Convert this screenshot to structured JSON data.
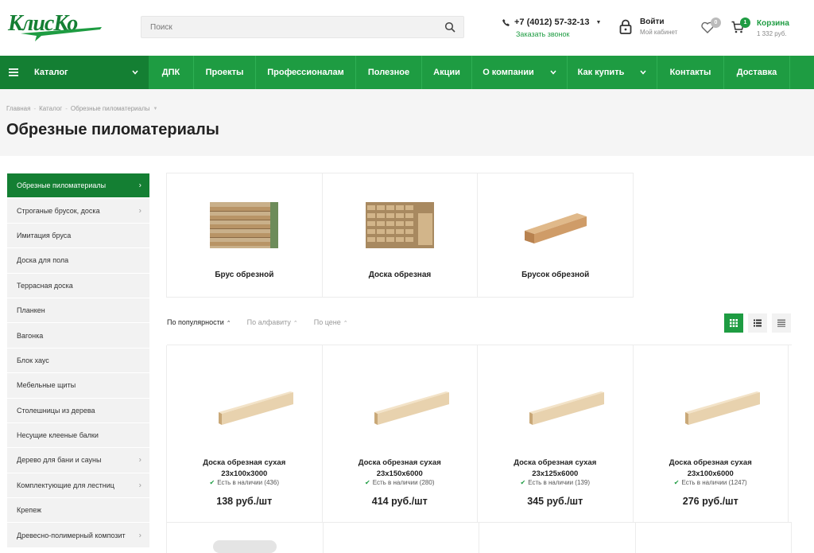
{
  "header": {
    "logo_text": "КлисКо",
    "search_placeholder": "Поиск",
    "phone": "+7 (4012) 57-32-13",
    "callback_label": "Заказать звонок",
    "login_title": "Войти",
    "login_sub": "Мой кабинет",
    "favorites_count": "0",
    "cart_count": "1",
    "cart_title": "Корзина",
    "cart_sum": "1 332 руб."
  },
  "nav": {
    "catalog_label": "Каталог",
    "items": [
      "ДПК",
      "Проекты",
      "Профессионалам",
      "Полезное",
      "Акции",
      "О компании",
      "Как купить",
      "Контакты",
      "Доставка"
    ]
  },
  "breadcrumb": [
    "Главная",
    "Каталог",
    "Обрезные пиломатериалы"
  ],
  "page_title": "Обрезные пиломатериалы",
  "sidebar": [
    "Обрезные пиломатериалы",
    "Строганые брусок, доска",
    "Имитация бруса",
    "Доска для пола",
    "Террасная доска",
    "Планкен",
    "Вагонка",
    "Блок хаус",
    "Мебельные щиты",
    "Столешницы из дерева",
    "Несущие клееные балки",
    "Дерево для бани и сауны",
    "Комплектующие для лестниц",
    "Крепеж",
    "Древесно-полимерный композит"
  ],
  "categories": [
    "Брус обрезной",
    "Доска обрезная",
    "Брусок обрезной"
  ],
  "sort": [
    "По популярности",
    "По алфавиту",
    "По цене"
  ],
  "products": [
    {
      "name": "Доска обрезная сухая",
      "size": "23x100x3000",
      "stock": "Есть в наличии (436)",
      "price": "138 руб./шт"
    },
    {
      "name": "Доска обрезная сухая",
      "size": "23x150x6000",
      "stock": "Есть в наличии (280)",
      "price": "414 руб./шт"
    },
    {
      "name": "Доска обрезная сухая",
      "size": "23x125x6000",
      "stock": "Есть в наличии (139)",
      "price": "345 руб./шт"
    },
    {
      "name": "Доска обрезная сухая",
      "size": "23x100x6000",
      "stock": "Есть в наличии (1247)",
      "price": "276 руб./шт"
    }
  ],
  "colors": {
    "brand_green": "#1e9c42",
    "dark_green": "#147f33"
  }
}
